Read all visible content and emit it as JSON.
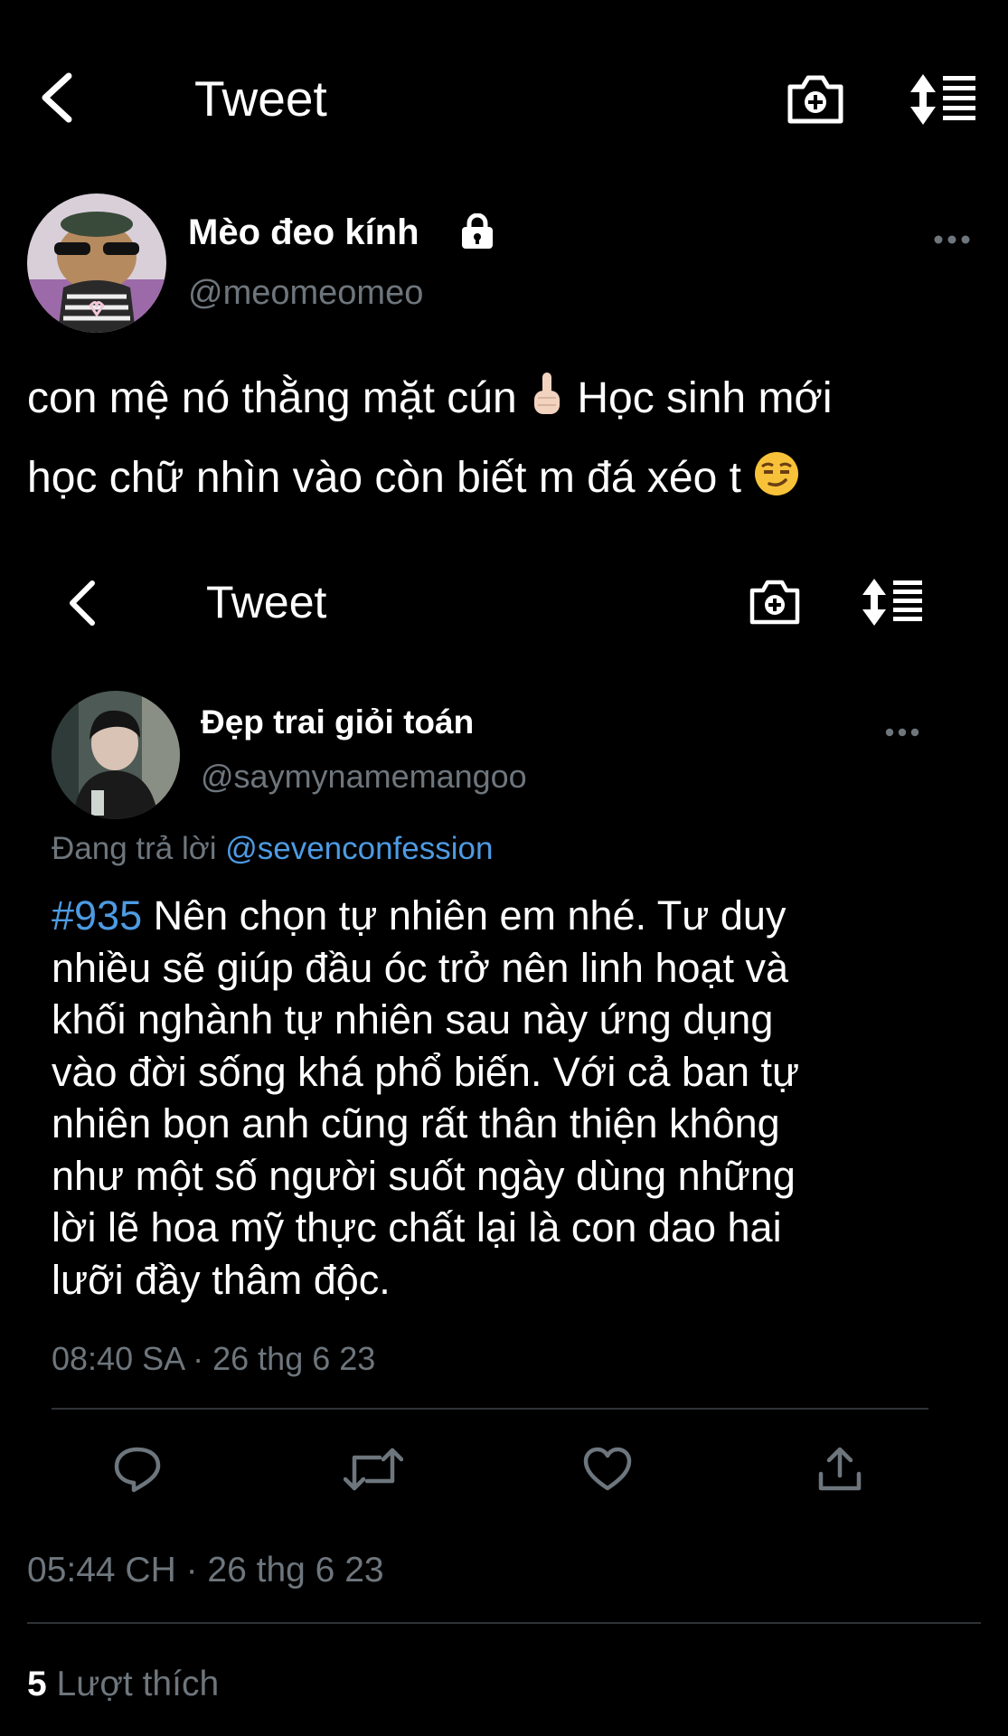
{
  "header": {
    "title": "Tweet",
    "icons": [
      "back-arrow-icon",
      "camera-plus-icon",
      "sort-icon"
    ]
  },
  "tweet": {
    "author_name": "Mèo đeo kính",
    "handle": "@meomeomeo",
    "text_line1": "con mệ nó thằng mặt cún",
    "text_line1b": " Học sinh mới",
    "text_line2": "học chữ nhìn vào còn biết m đá xéo t",
    "timestamp": "05:44 CH · 26 thg 6 23",
    "likes_count": "5",
    "likes_label": " Lượt thích",
    "emojis": [
      "pointing-finger-emoji",
      "smirk-emoji"
    ]
  },
  "quoted_screenshot": {
    "header_title": "Tweet",
    "author_name": "Đẹp trai giỏi toán",
    "handle": "@saymynamemangoo",
    "reply_prefix": "Đang trả lời ",
    "reply_to": "@sevenconfession",
    "hashtag": "#935",
    "text_lines": [
      " Nên chọn tự nhiên em nhé. Tư duy",
      "nhiều sẽ giúp đầu óc trở nên linh hoạt và",
      "khối nghành tự nhiên sau này ứng dụng",
      "vào đời sống khá phổ biến. Với cả ban tự",
      "nhiên bọn anh cũng rất thân thiện không",
      "như một số người suốt ngày dùng những",
      "lời lẽ hoa mỹ thực chất lại là con dao hai",
      "lưỡi đầy thâm độc."
    ],
    "timestamp": "08:40 SA · 26 thg 6 23",
    "actions": [
      "reply-icon",
      "retweet-icon",
      "like-icon",
      "share-icon"
    ]
  },
  "colors": {
    "background": "#000000",
    "text": "#ffffff",
    "muted": "#6e767d",
    "link": "#4d9be3",
    "divider": "#2f3336"
  }
}
